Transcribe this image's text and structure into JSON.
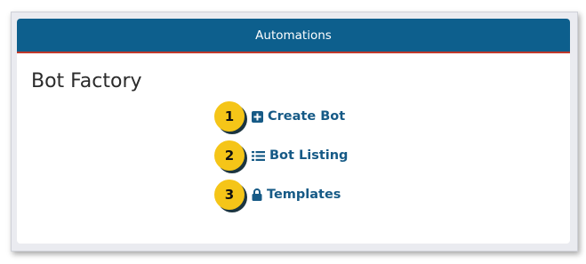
{
  "header": {
    "title": "Automations"
  },
  "page": {
    "title": "Bot Factory"
  },
  "menu": [
    {
      "step": "1",
      "label": "Create Bot",
      "icon": "plus-square-icon"
    },
    {
      "step": "2",
      "label": "Bot Listing",
      "icon": "list-icon"
    },
    {
      "step": "3",
      "label": "Templates",
      "icon": "lock-icon"
    }
  ],
  "colors": {
    "header_bg": "#0d5f8d",
    "header_accent": "#c0392b",
    "badge": "#f5c518",
    "link": "#165a86"
  }
}
